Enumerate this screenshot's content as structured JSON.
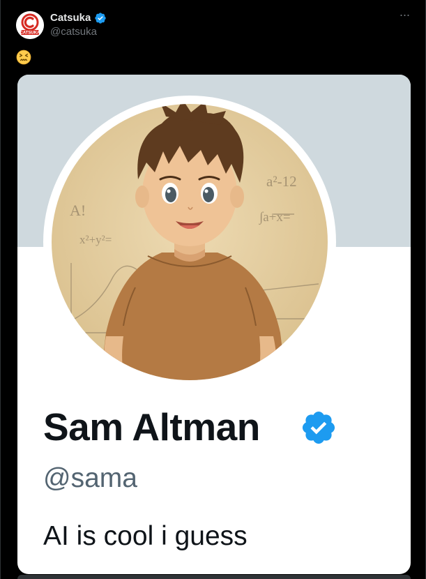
{
  "post": {
    "author": {
      "name": "Catsuka",
      "handle": "@catsuka",
      "avatar_logo_text": "CATSUKA",
      "verified": true
    },
    "more_icon": "more-horizontal-icon",
    "text_emoji": "confounded-face-emoji"
  },
  "profile_card": {
    "display_name": "Sam Altman",
    "handle": "@sama",
    "bio": "AI is cool i guess",
    "verified": true,
    "profile_picture": "anime-style-portrait",
    "chalkboard_scribbles": [
      "A!",
      "x²+y²=",
      "a²-12",
      "∫a+x="
    ]
  },
  "colors": {
    "background": "#000000",
    "primary_text": "#e7e9ea",
    "secondary_text": "#71767b",
    "verified_badge": "#1d9bf0",
    "banner": "#cfd9de",
    "card_text": "#0f1419",
    "card_handle": "#536471"
  }
}
